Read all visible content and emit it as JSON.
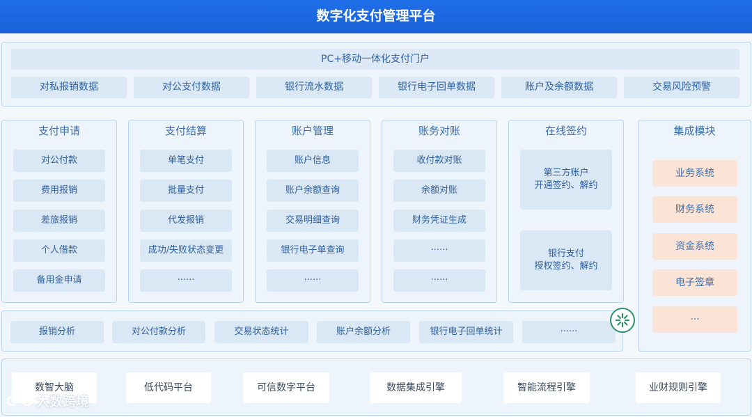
{
  "title": "数字化支付管理平台",
  "portal": {
    "heading": "PC+移动一体化支付门户",
    "items": [
      "对私报销数据",
      "对公支付数据",
      "银行流水数据",
      "银行电子回单数据",
      "账户及余额数据",
      "交易风险预警"
    ]
  },
  "modules": [
    {
      "title": "支付申请",
      "items": [
        "对公付款",
        "费用报销",
        "差旅报销",
        "个人借款",
        "备用金申请"
      ]
    },
    {
      "title": "支付结算",
      "items": [
        "单笔支付",
        "批量支付",
        "代发报销",
        "成功/失败状态变更",
        "······"
      ]
    },
    {
      "title": "账户管理",
      "items": [
        "账户信息",
        "账户余额查询",
        "交易明细查询",
        "银行电子单查询",
        "······"
      ]
    },
    {
      "title": "账务对账",
      "items": [
        "收付款对账",
        "余额对账",
        "财务凭证生成",
        "······",
        "······"
      ]
    }
  ],
  "signing": {
    "title": "在线签约",
    "items": [
      {
        "line1": "第三方账户",
        "line2": "开通签约、解约"
      },
      {
        "line1": "银行支付",
        "line2": "授权签约、解约"
      }
    ]
  },
  "integration": {
    "title": "集成模块",
    "items": [
      "业务系统",
      "财务系统",
      "资金系统",
      "电子签章",
      "···"
    ]
  },
  "analysis": {
    "items": [
      "报销分析",
      "对公付款分析",
      "交易状态统计",
      "账户余额分析",
      "银行电子回单统计",
      "······"
    ]
  },
  "base": {
    "items": [
      "数智大脑",
      "低代码平台",
      "可信数字平台",
      "数据集成引擎",
      "智能流程引擎",
      "业财规则引擎"
    ]
  },
  "watermark": "大数跨境",
  "colors": {
    "title_bar": "#1f6ee8",
    "integration_item": "#fbe3d5",
    "badge": "#2e8f6f"
  }
}
